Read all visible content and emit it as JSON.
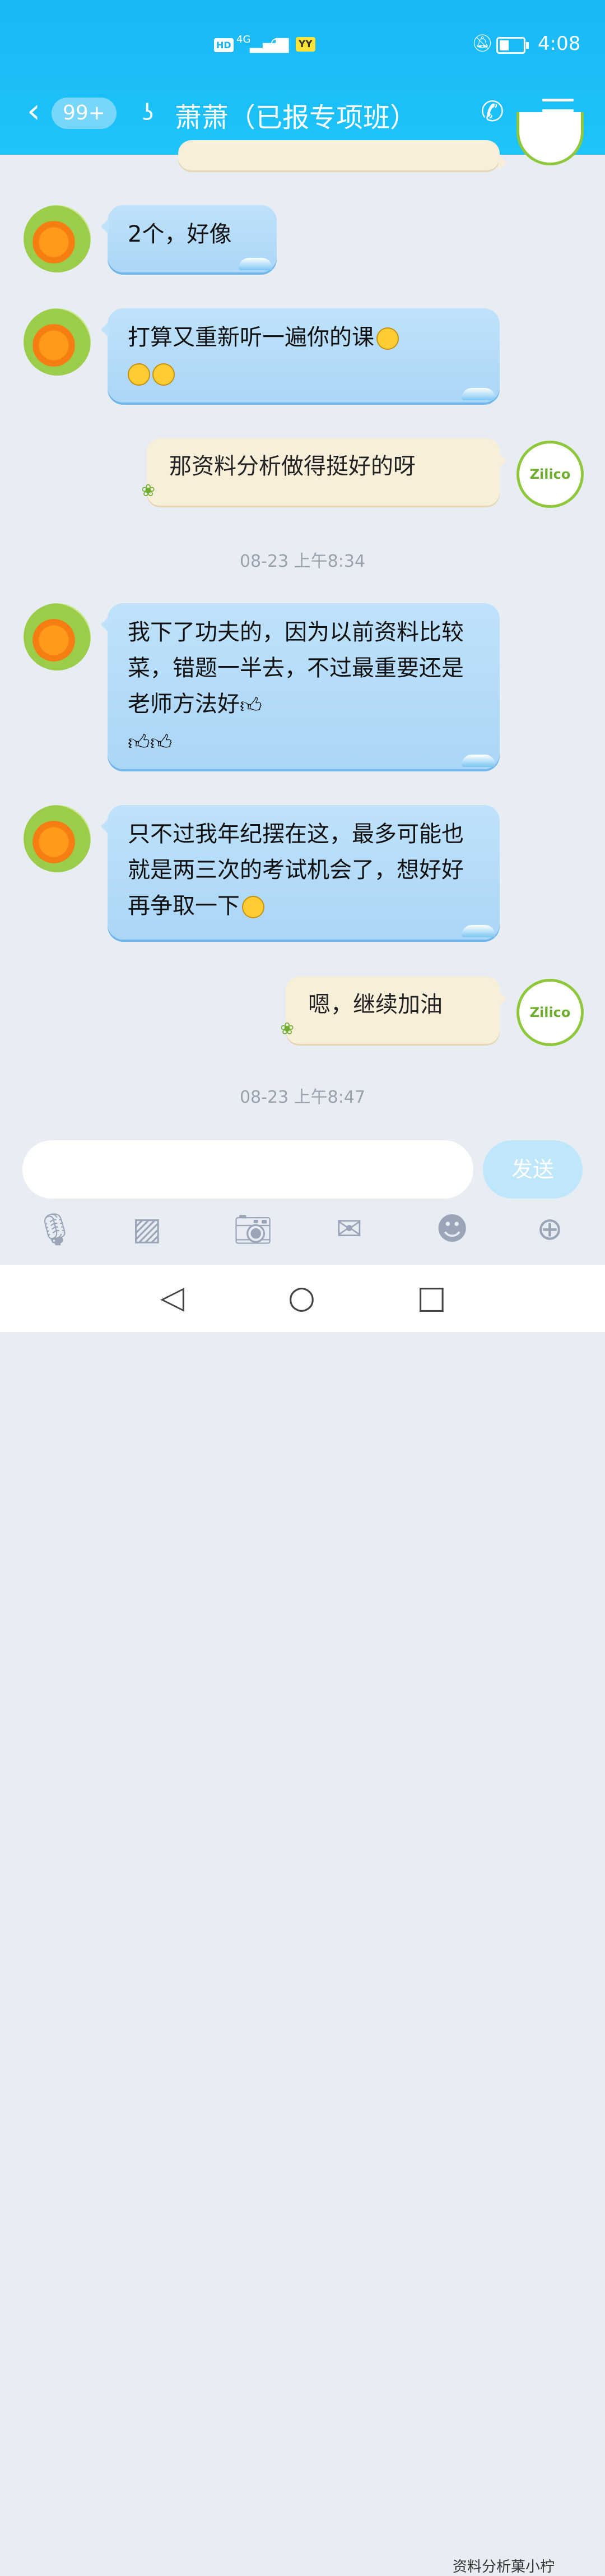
{
  "status_bar": {
    "hd": "HD",
    "network": "4G",
    "yy": "YY",
    "time": "4:08"
  },
  "header": {
    "back_icon": "chevron-left",
    "unread_count": "99+",
    "contact_name": "萧萧（已报专项班）",
    "call_icon": "phone",
    "menu_icon": "menu"
  },
  "messages": [
    {
      "side": "left",
      "text": "2个，好像"
    },
    {
      "side": "left",
      "text": "打算又重新听一遍你的课",
      "emojis": [
        "grin",
        "grin",
        "grin"
      ]
    },
    {
      "side": "right",
      "text": "那资料分析做得挺好的呀"
    },
    {
      "timestamp": "08-23 上午8:34"
    },
    {
      "side": "left",
      "text": "我下了功夫的，因为以前资料比较菜，错题一半去，不过最重要还是老师方法好",
      "emojis": [
        "thumbs-up",
        "thumbs-up",
        "thumbs-up"
      ]
    },
    {
      "side": "left",
      "text": "只不过我年纪摆在这，最多可能也就是两三次的考试机会了，想好好再争取一下",
      "emojis": [
        "smile"
      ]
    },
    {
      "side": "right",
      "text": "嗯，继续加油"
    },
    {
      "timestamp": "08-23 上午8:47"
    }
  ],
  "composer": {
    "placeholder": "",
    "send_label": "发送"
  },
  "toolbar": [
    "microphone-icon",
    "image-icon",
    "camera-icon",
    "red-packet-icon",
    "emoji-icon",
    "plus-icon"
  ],
  "watermark": "资料分析菓小柠",
  "colors": {
    "header": "#1ec4fb",
    "bubble_left": "#aad6f7",
    "bubble_right": "#f7efd9"
  }
}
